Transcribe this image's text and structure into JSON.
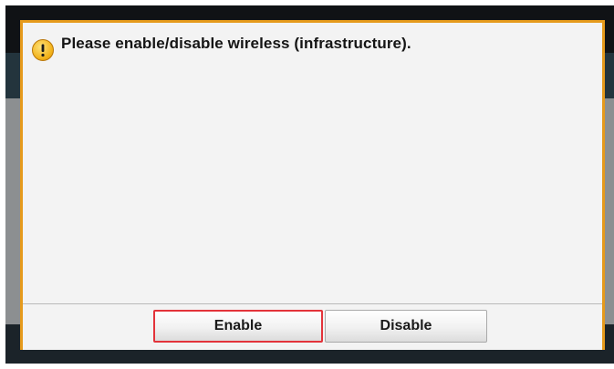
{
  "dialog": {
    "message": "Please enable/disable wireless (infrastructure).",
    "icon": "warning-icon",
    "accent_color": "#e59a1c",
    "buttons": {
      "enable_label": "Enable",
      "disable_label": "Disable",
      "highlight_color": "#e3333a"
    }
  }
}
